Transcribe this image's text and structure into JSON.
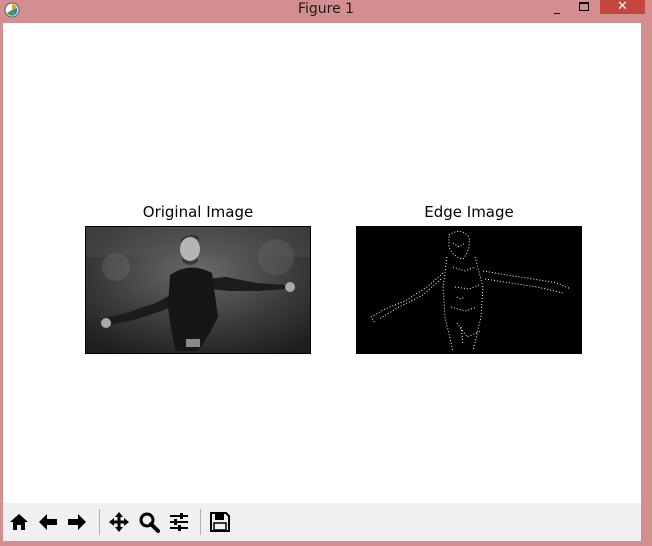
{
  "window": {
    "title": "Figure 1",
    "controls": [
      "minimize",
      "maximize",
      "close"
    ],
    "close_glyph": "✕",
    "min_glyph": "_"
  },
  "figure": {
    "axes": [
      {
        "title": "Original Image"
      },
      {
        "title": "Edge Image"
      }
    ]
  },
  "toolbar": {
    "buttons": [
      {
        "name": "home-icon"
      },
      {
        "name": "back-arrow-icon"
      },
      {
        "name": "forward-arrow-icon"
      },
      {
        "name": "pan-icon"
      },
      {
        "name": "zoom-icon"
      },
      {
        "name": "subplots-configure-icon"
      },
      {
        "name": "save-icon"
      }
    ]
  },
  "colors": {
    "titlebar": "#d38f8f",
    "close_button": "#c5463c",
    "toolbar": "#f0f0f0"
  }
}
